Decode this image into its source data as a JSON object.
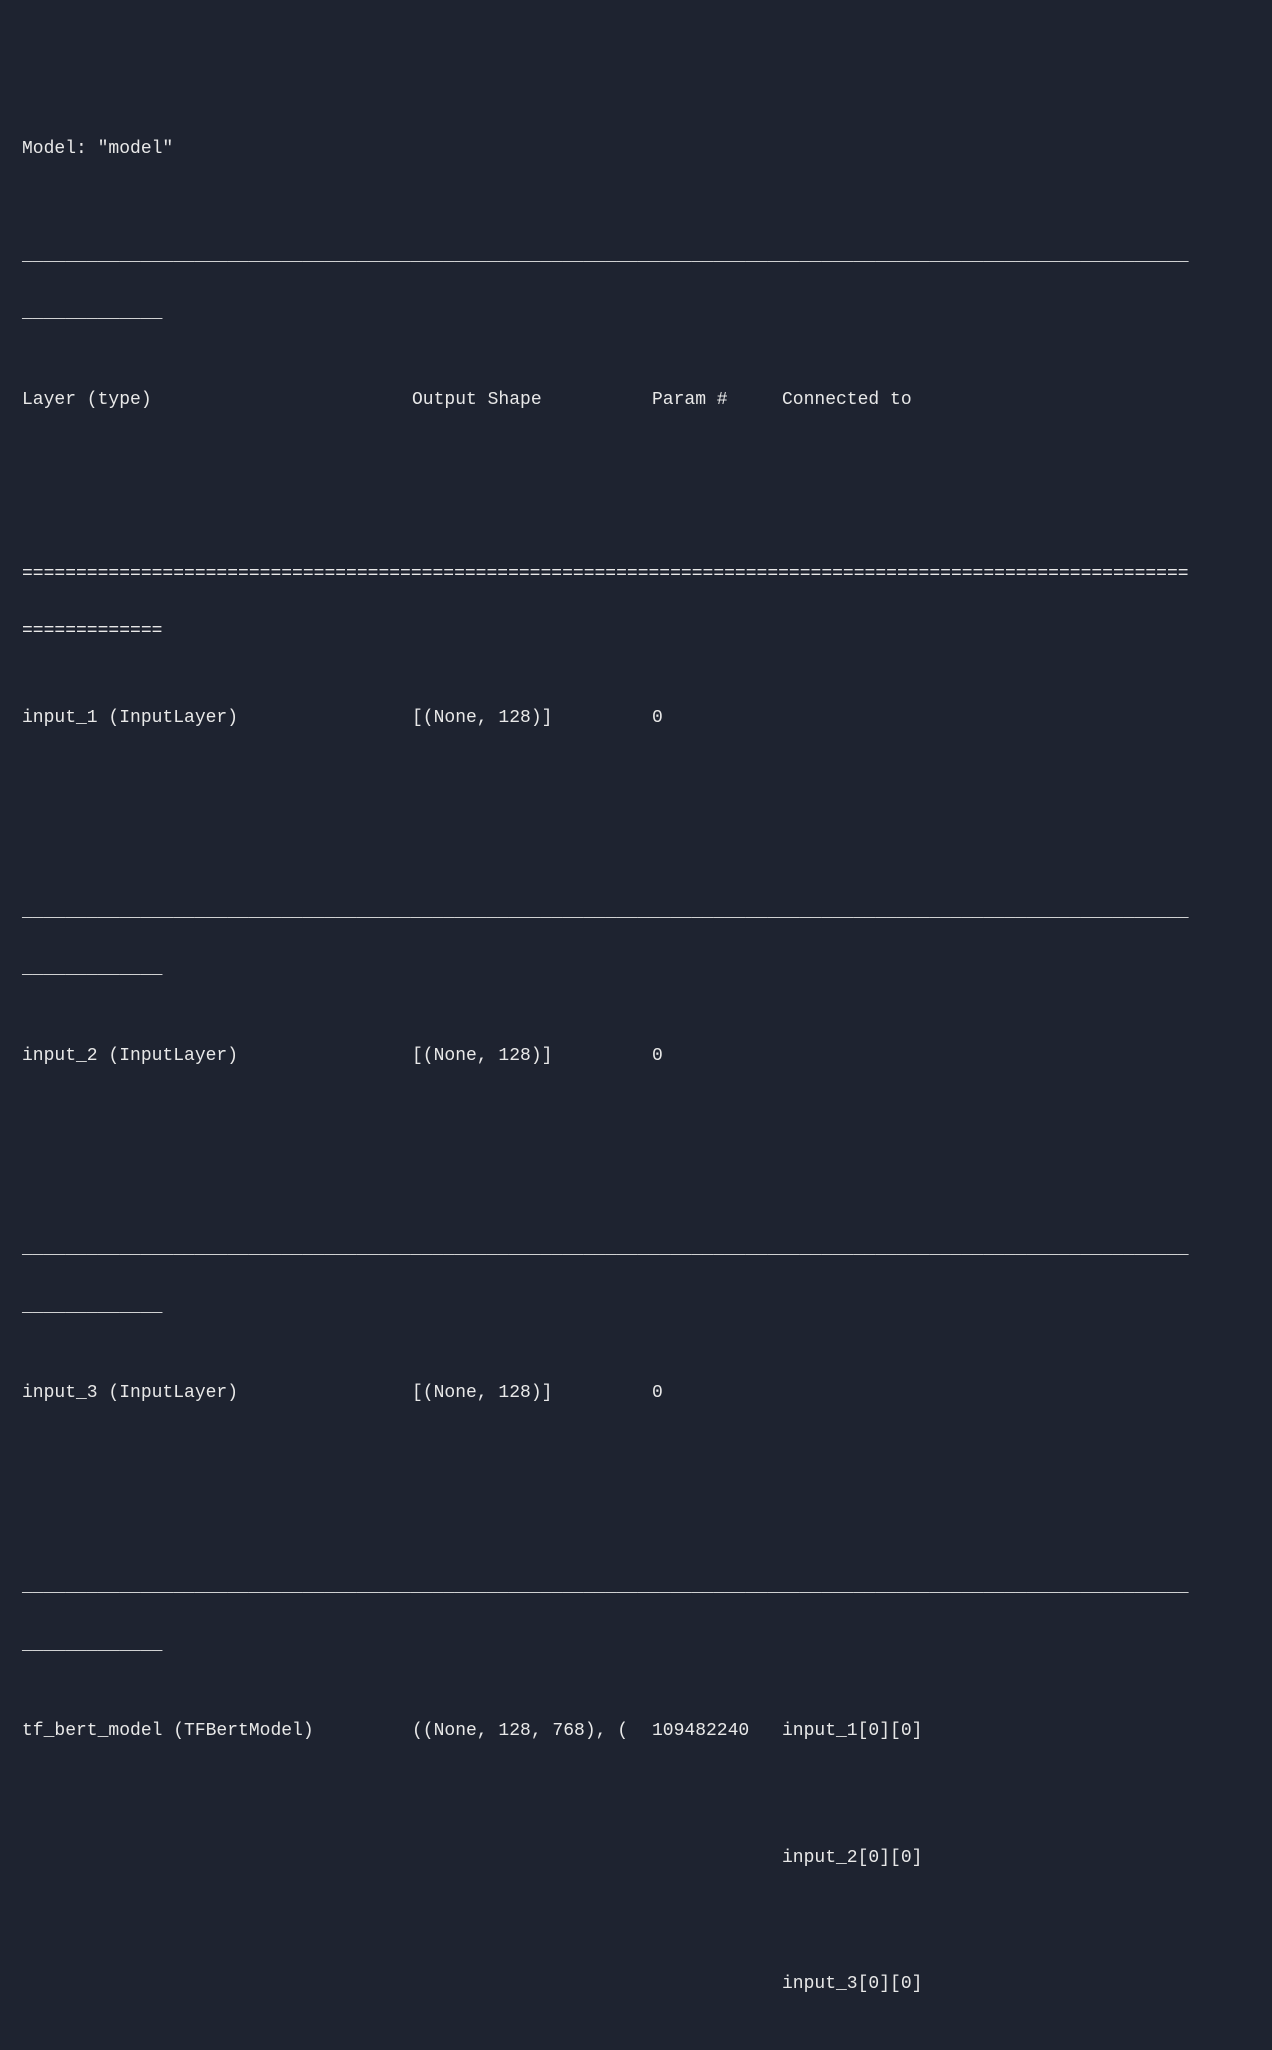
{
  "model_title": "Model: \"model\"",
  "separator_dash_long": "____________________________________________________________________________________________________________",
  "separator_dash_short": "_____________",
  "separator_eq_long": "============================================================================================================",
  "separator_eq_short": "=============",
  "headers": {
    "layer": "Layer (type)",
    "output": "Output Shape",
    "param": "Param #",
    "connected": "Connected to"
  },
  "rows": [
    {
      "layer": "input_1 (InputLayer)",
      "output": "[(None, 128)]",
      "param": "0",
      "connected": []
    },
    {
      "layer": "input_2 (InputLayer)",
      "output": "[(None, 128)]",
      "param": "0",
      "connected": []
    },
    {
      "layer": "input_3 (InputLayer)",
      "output": "[(None, 128)]",
      "param": "0",
      "connected": []
    },
    {
      "layer": "tf_bert_model (TFBertModel)",
      "output": "((None, 128, 768), (",
      "param": "109482240",
      "connected": [
        "input_1[0][0]",
        "input_2[0][0]",
        "input_3[0][0]"
      ]
    }
  ],
  "connected_extra_1": "input_2[0][0]",
  "connected_extra_2": "input_3[0][0]"
}
